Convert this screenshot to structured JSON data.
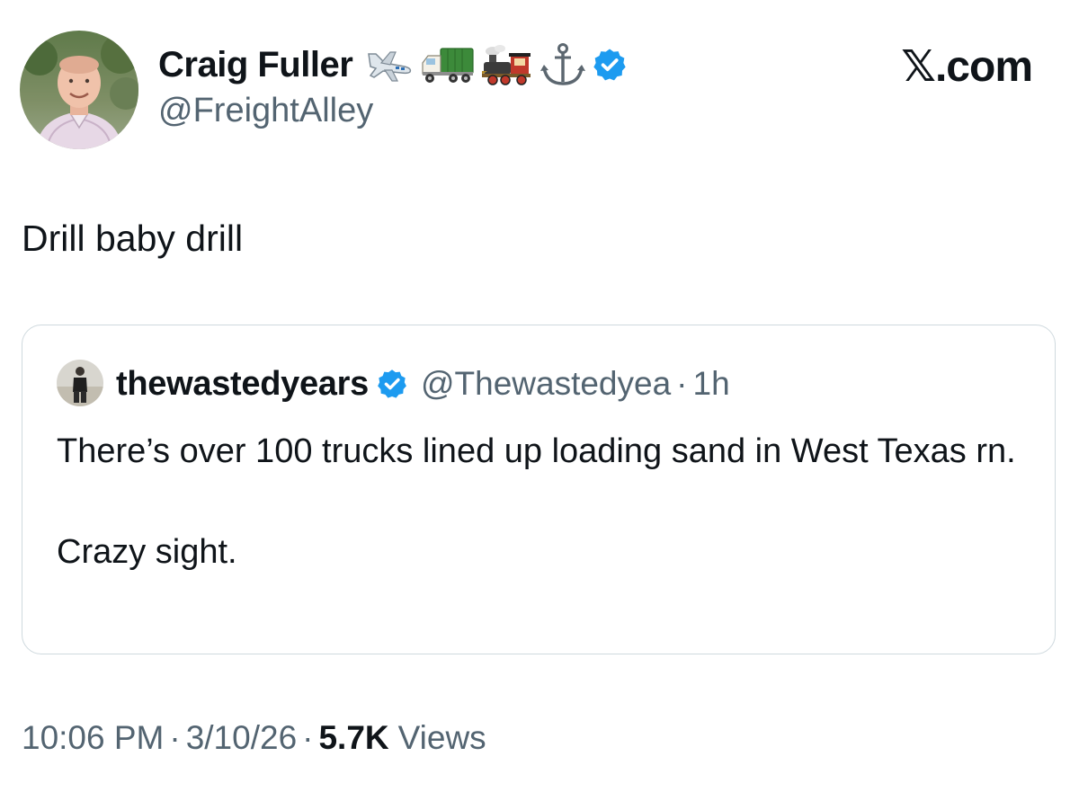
{
  "colors": {
    "text_primary": "#0f1419",
    "text_secondary": "#536471",
    "verified_blue": "#1d9bf0",
    "border": "#cfd9de"
  },
  "brand": {
    "label": "𝕏.com"
  },
  "author": {
    "name": "Craig Fuller",
    "handle": "@FreightAlley",
    "name_emojis": [
      "airplane-icon",
      "truck-icon",
      "locomotive-icon",
      "anchor-icon"
    ],
    "verified": true
  },
  "tweet": {
    "text": "Drill baby drill"
  },
  "quoted_tweet": {
    "name": "thewastedyears",
    "handle": "@Thewastedyea",
    "separator": "·",
    "time": "1h",
    "verified": true,
    "paragraph_1": "There’s over 100 trucks lined up loading sand in West Texas rn.",
    "paragraph_2": "Crazy sight."
  },
  "footer": {
    "time": "10:06 PM",
    "separator": "·",
    "date": "3/10/26",
    "views_count": "5.7K",
    "views_label": "Views"
  }
}
